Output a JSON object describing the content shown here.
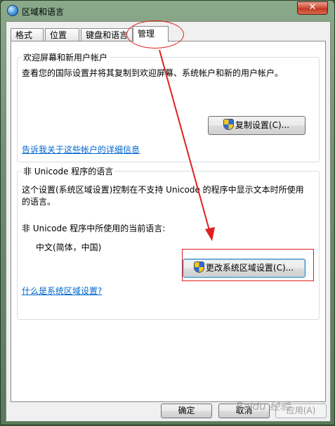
{
  "window": {
    "title": "区域和语言",
    "close_glyph": "✕"
  },
  "tabs": [
    {
      "label": "格式"
    },
    {
      "label": "位置"
    },
    {
      "label": "键盘和语言"
    },
    {
      "label": "管理"
    }
  ],
  "welcome_group": {
    "title": "欢迎屏幕和新用户帐户",
    "description": "查看您的国际设置并将其复制到欢迎屏幕、系统帐户和新的用户帐户。",
    "copy_button": "复制设置(C)...",
    "link": "告诉我关于这些帐户的详细信息"
  },
  "unicode_group": {
    "title": "非 Unicode 程序的语言",
    "description": "这个设置(系统区域设置)控制在不支持 Unicode 的程序中显示文本时所使用的语言。",
    "current_label": "非 Unicode 程序中所使用的当前语言:",
    "current_value": "中文(简体，中国)",
    "change_button": "更改系统区域设置(C)...",
    "link": "什么是系统区域设置?"
  },
  "footer": {
    "ok": "确定",
    "cancel": "取消",
    "apply": "应用(A)"
  },
  "watermark": "Baidu 经验",
  "annotation_color": "#e02020"
}
